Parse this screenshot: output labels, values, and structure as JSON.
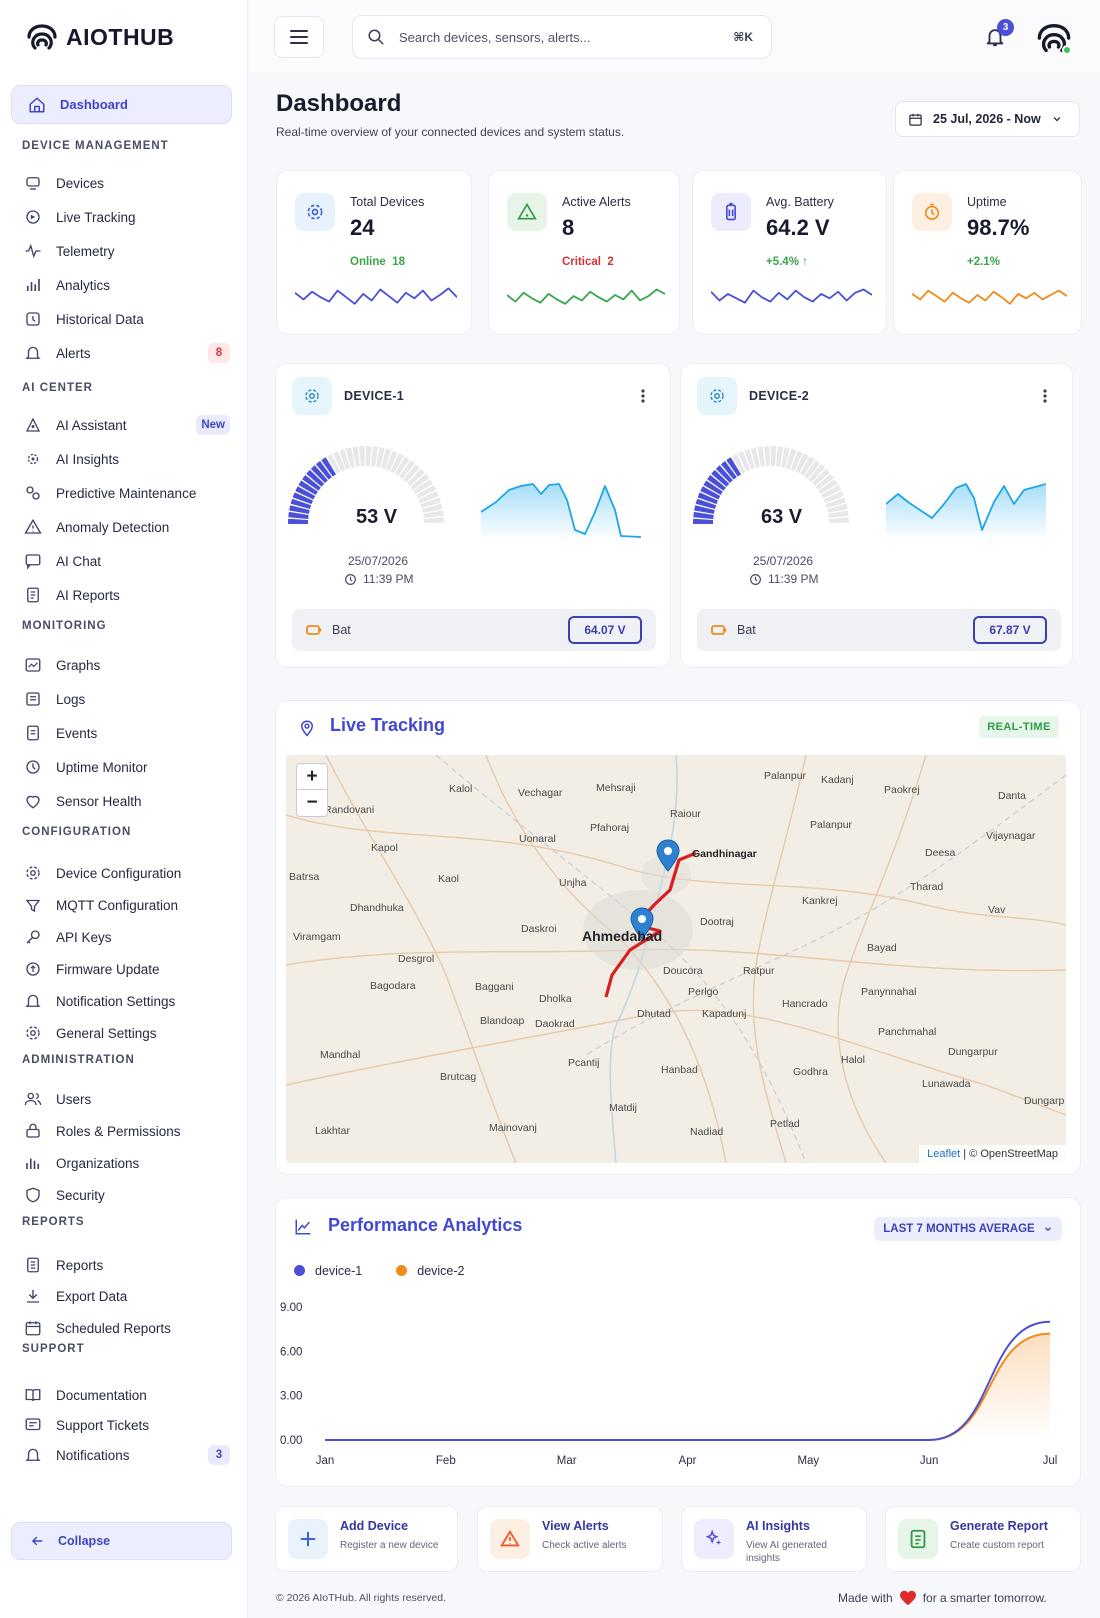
{
  "app": {
    "name": "AIOTHUB"
  },
  "sidebar": {
    "active": "Dashboard",
    "sections": [
      {
        "title": "DEVICE MANAGEMENT",
        "items": [
          "Devices",
          "Live Tracking",
          "Telemetry",
          "Analytics",
          "Historical Data",
          "Alerts"
        ]
      },
      {
        "title": "AI CENTER",
        "items": [
          "AI Assistant",
          "AI Insights",
          "Predictive Maintenance",
          "Anomaly Detection",
          "AI Chat",
          "AI Reports"
        ]
      },
      {
        "title": "MONITORING",
        "items": [
          "Graphs",
          "Logs",
          "Events",
          "Uptime Monitor",
          "Sensor Health"
        ]
      },
      {
        "title": "CONFIGURATION",
        "items": [
          "Device Configuration",
          "MQTT Configuration",
          "API Keys",
          "Firmware Update",
          "Notification Settings",
          "General Settings"
        ]
      },
      {
        "title": "ADMINISTRATION",
        "items": [
          "Users",
          "Roles & Permissions",
          "Organizations",
          "Security"
        ]
      },
      {
        "title": "REPORTS",
        "items": [
          "Reports",
          "Export Data",
          "Scheduled Reports"
        ]
      },
      {
        "title": "SUPPORT",
        "items": [
          "Documentation",
          "Support Tickets",
          "Notifications"
        ]
      }
    ],
    "alerts_badge": "8",
    "ai_assistant_badge": "New",
    "notifications_badge": "3",
    "collapse_label": "Collapse"
  },
  "topbar": {
    "search_placeholder": "Search devices, sensors, alerts...",
    "shortcut": "⌘K",
    "notif_count": "3"
  },
  "page": {
    "title": "Dashboard",
    "subtitle": "Real-time overview of your connected devices and system status.",
    "date_range": "25 Jul, 2026 - Now"
  },
  "stats": [
    {
      "label": "Total Devices",
      "value": "24",
      "sub_label": "Online",
      "sub_value": "18",
      "color": "#3aa54b",
      "accent": "#4a4fd6"
    },
    {
      "label": "Active Alerts",
      "value": "8",
      "sub_label": "Critical",
      "sub_value": "2",
      "color": "#d63232",
      "accent": "#3aa54b"
    },
    {
      "label": "Avg. Battery",
      "value": "64.2 V",
      "sub_label": "+5.4%",
      "sub_value": "",
      "color": "#3aa54b",
      "accent": "#4a4fd6"
    },
    {
      "label": "Uptime",
      "value": "98.7%",
      "sub_label": "+2.1%",
      "sub_value": "",
      "color": "#3aa54b",
      "accent": "#f08a1c"
    }
  ],
  "devices": [
    {
      "name": "DEVICE-1",
      "value": "53 V",
      "level": 53,
      "date": "25/07/2026",
      "time": "11:39 PM",
      "bat_label": "Bat",
      "bat_value": "64.07 V"
    },
    {
      "name": "DEVICE-2",
      "value": "63 V",
      "level": 63,
      "date": "25/07/2026",
      "time": "11:39 PM",
      "bat_label": "Bat",
      "bat_value": "67.87 V"
    }
  ],
  "tracking": {
    "title": "Live Tracking",
    "badge": "REAL-TIME",
    "attribution_link": "Leaflet",
    "attribution_rest": "| © OpenStreetMap",
    "zoom_in": "+",
    "zoom_out": "−",
    "places": [
      "Palanpur",
      "Kadanj",
      "Paokrej",
      "Danta",
      "Kalol",
      "Vechagar",
      "Mehsraji",
      "Randovani",
      "Pfahoraj",
      "Raiour",
      "Palanpur",
      "Vijaynagar",
      "Uonaral",
      "Gandhinagar",
      "Kapol",
      "Deesa",
      "Batrsa",
      "Kaol",
      "Unjha",
      "Tharad",
      "Dhandhuka",
      "Kankrej",
      "Vav",
      "Viramgam",
      "Daskroi",
      "Ahmedabad",
      "Dootraj",
      "Bayad",
      "Desgrol",
      "Doucora",
      "Ratpur",
      "Bagodara",
      "Baggani",
      "Dholka",
      "Perlgo",
      "Hancrado",
      "Panynnahal",
      "Blandoap",
      "Daokrad",
      "Dhutad",
      "Kapadunj",
      "Panchmahal",
      "Mandhal",
      "Halol",
      "Dungarpur",
      "Pcantij",
      "Hanbad",
      "Godhra",
      "Brutcag",
      "Lunawada",
      "Matdij",
      "Dungarp",
      "Lakhtar",
      "Mainovanj",
      "Nadiad",
      "Petlad"
    ]
  },
  "performance": {
    "title": "Performance Analytics",
    "filter": "LAST 7 MONTHS AVERAGE"
  },
  "chart_data": {
    "type": "area",
    "categories": [
      "Jan",
      "Feb",
      "Mar",
      "Apr",
      "May",
      "Jun",
      "Jul"
    ],
    "series": [
      {
        "name": "device-1",
        "values": [
          0,
          0,
          0,
          0,
          0,
          0,
          8.0
        ],
        "color": "#4a4fd6"
      },
      {
        "name": "device-2",
        "values": [
          0,
          0,
          0,
          0,
          0,
          0,
          7.2
        ],
        "color": "#f08a1c"
      }
    ],
    "yticks": [
      "0.00",
      "3.00",
      "6.00",
      "9.00"
    ],
    "ylim": [
      0,
      9
    ],
    "legend": "top-left",
    "grid": false
  },
  "quick_actions": [
    {
      "title": "Add Device",
      "sub": "Register a new device"
    },
    {
      "title": "View Alerts",
      "sub": "Check active alerts"
    },
    {
      "title": "AI Insights",
      "sub": "View AI generated insights"
    },
    {
      "title": "Generate Report",
      "sub": "Create custom report"
    }
  ],
  "footer": {
    "left": "© 2026 AIoTHub. All rights reserved.",
    "right_a": "Made with",
    "right_b": "for a smarter tomorrow."
  }
}
